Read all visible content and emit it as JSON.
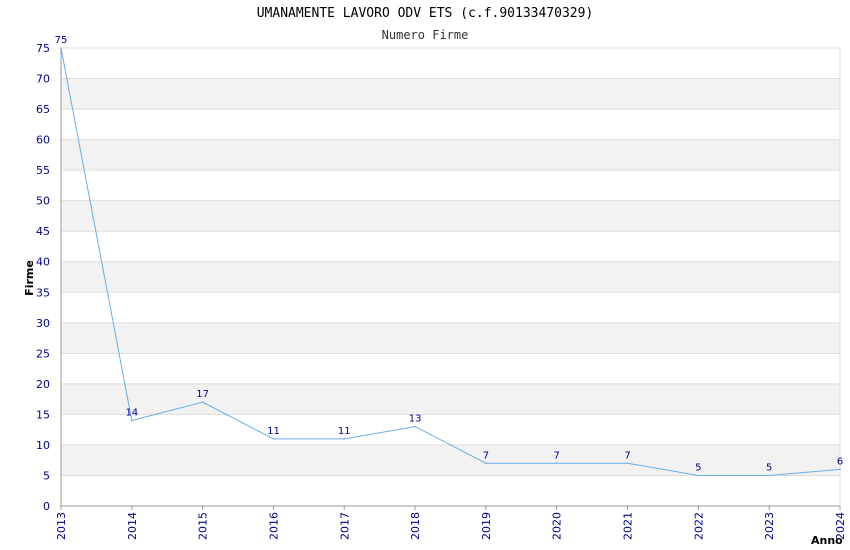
{
  "chart_data": {
    "type": "line",
    "title": "UMANAMENTE LAVORO ODV ETS (c.f.90133470329)",
    "subtitle": "Numero Firme",
    "xlabel": "Anno",
    "ylabel": "Firme",
    "x": [
      "2013",
      "2014",
      "2015",
      "2016",
      "2017",
      "2018",
      "2019",
      "2020",
      "2021",
      "2022",
      "2023",
      "2024"
    ],
    "series": [
      {
        "values": [
          75,
          14,
          17,
          11,
          11,
          13,
          7,
          7,
          7,
          5,
          5,
          6
        ]
      }
    ],
    "ylim": [
      0,
      75
    ],
    "ytick_step": 5,
    "grid": true,
    "colors": {
      "line": "#6aaee8",
      "band": "#f2f2f2",
      "tick_label": "#00008b",
      "grid": "#dddddd"
    }
  }
}
